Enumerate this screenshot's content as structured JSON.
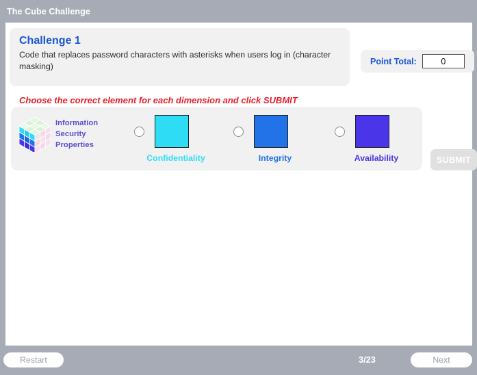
{
  "window": {
    "title": "The Cube Challenge"
  },
  "challenge": {
    "title": "Challenge 1",
    "description": "Code that replaces password characters with asterisks when users log in (character masking)"
  },
  "score": {
    "label": "Point Total:",
    "value": "0"
  },
  "instruction": "Choose the correct element for each dimension and click SUBMIT",
  "dimension": {
    "icon_name": "rubiks-cube-icon",
    "caption": "Information Security Properties",
    "caption_color": "#5b4fd0",
    "cube_colors": {
      "top": "#dff3df",
      "right": "#fadfec",
      "left_row1": "#2edcf5",
      "left_row2": "#2272e8",
      "left_row3": "#4b35e8"
    }
  },
  "options": [
    {
      "label": "Confidentiality",
      "color": "#2edcf5",
      "selected": false,
      "radio_name": "radio-confidentiality",
      "swatch_name": "swatch-confidentiality"
    },
    {
      "label": "Integrity",
      "color": "#2272e8",
      "selected": false,
      "radio_name": "radio-integrity",
      "swatch_name": "swatch-integrity"
    },
    {
      "label": "Availability",
      "color": "#4b35e8",
      "selected": false,
      "radio_name": "radio-availability",
      "swatch_name": "swatch-availability"
    }
  ],
  "submit": {
    "label": "SUBMIT",
    "enabled": false
  },
  "footer": {
    "restart_label": "Restart",
    "next_label": "Next",
    "page_counter": "3/23"
  }
}
